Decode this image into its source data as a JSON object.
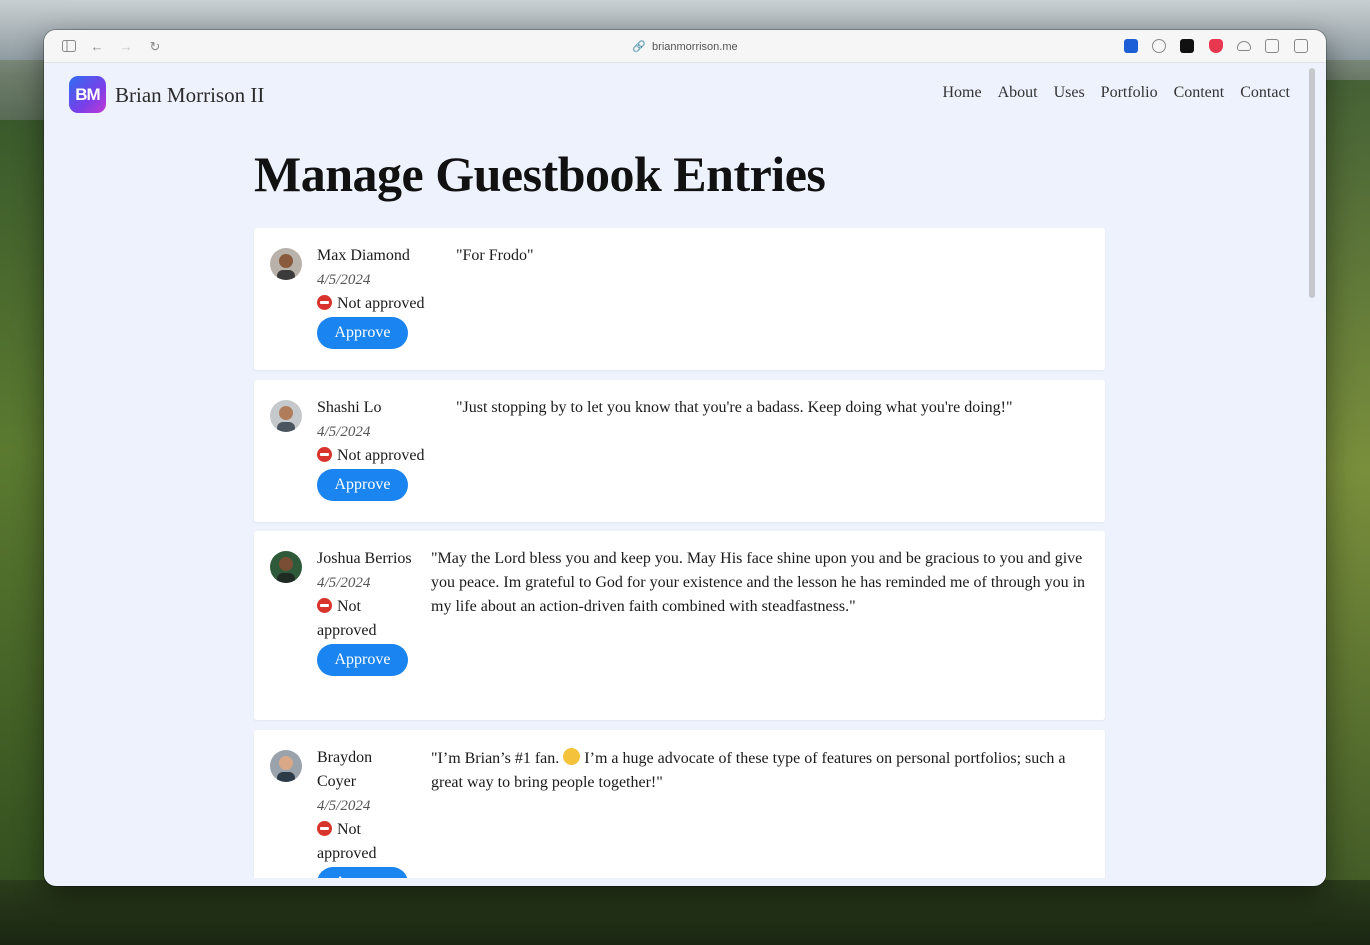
{
  "browser": {
    "url": "brianmorrison.me",
    "toolbar_icons": [
      "sidebar-icon",
      "back-icon",
      "forward-icon",
      "reload-icon"
    ],
    "extension_icons": [
      "bitwarden-icon",
      "grammarly-icon",
      "notion-icon",
      "pocket-icon",
      "cloud-icon",
      "reader-icon",
      "split-view-icon"
    ]
  },
  "site": {
    "logo_text": "BM",
    "name": "Brian Morrison II",
    "nav": [
      "Home",
      "About",
      "Uses",
      "Portfolio",
      "Content",
      "Contact"
    ]
  },
  "main": {
    "title": "Manage Guestbook Entries",
    "entries": [
      {
        "name": "Max Diamond",
        "date": "4/5/2024",
        "status": "Not approved",
        "action": "Approve",
        "message": "\"For Frodo\""
      },
      {
        "name": "Shashi Lo",
        "date": "4/5/2024",
        "status": "Not approved",
        "action": "Approve",
        "message": "\"Just stopping by to let you know that you're a badass. Keep doing what you're doing!\""
      },
      {
        "name": "Joshua Berrios",
        "date": "4/5/2024",
        "status": "Not approved",
        "action": "Approve",
        "message": "\"May the Lord bless you and keep you. May His face shine upon you and be gracious to you and give you peace. Im grateful to God for your existence and the lesson he has reminded me of through you in my life about an action-driven faith combined with steadfastness.\""
      },
      {
        "name": "Braydon Coyer",
        "date": "4/5/2024",
        "status": "Not approved",
        "action": "Approve",
        "message_before": "\"I’m Brian’s #1 fan.",
        "message_after": "I’m a huge advocate of these type of features on personal portfolios; such a great way to bring people together!\""
      }
    ]
  },
  "colors": {
    "accent": "#1a84f0",
    "page_bg": "#eef2fd",
    "status_icon": "#d8342c"
  }
}
